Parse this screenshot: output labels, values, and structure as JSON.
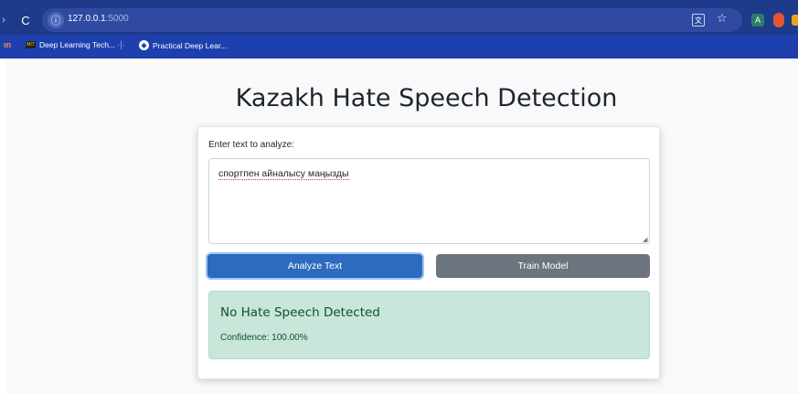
{
  "browser": {
    "back_glyph": "›",
    "reload_glyph": "C",
    "info_glyph": "ⓘ",
    "url_host": "127.0.0.1",
    "url_port": ":5000",
    "translate_glyph": "文",
    "star_glyph": "☆",
    "ext_glyph": "A"
  },
  "bookmarks": {
    "partial": "ın",
    "item1_fav": "MIT",
    "item1": "Deep Learning Tech...",
    "separator": "·|·",
    "item2": "Practical Deep Lear..."
  },
  "app": {
    "title": "Kazakh Hate Speech Detection",
    "input_label": "Enter text to analyze:",
    "input_value": "спортпен айналысу маңызды",
    "analyze_label": "Analyze Text",
    "train_label": "Train Model",
    "result_title": "No Hate Speech Detected",
    "result_confidence": "Confidence: 100.00%"
  },
  "colors": {
    "browser_bar": "#1e3a8a",
    "primary": "#2c6bbf",
    "secondary": "#6c757d",
    "success_bg": "#c8e6d9",
    "success_text": "#0f5132"
  }
}
